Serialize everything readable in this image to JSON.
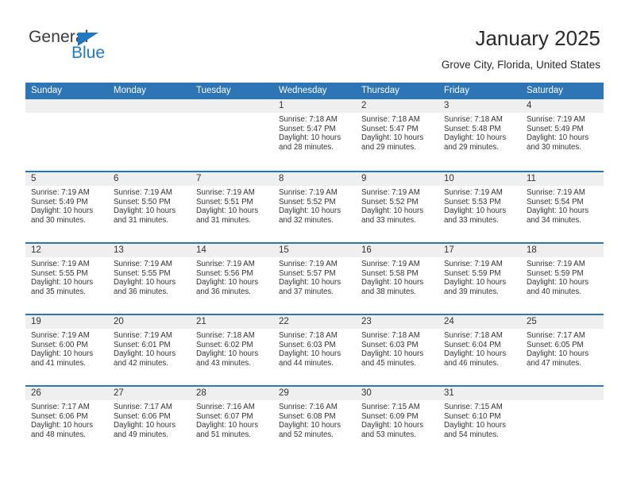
{
  "brand": {
    "name_top": "General",
    "name_bottom": "Blue",
    "triangle_icon": "triangle-icon",
    "accent_color": "#1f78c1"
  },
  "header": {
    "title": "January 2025",
    "subtitle": "Grove City, Florida, United States"
  },
  "theme": {
    "header_blue": "#2e75b6",
    "daynum_band": "#efefef",
    "text": "#333333"
  },
  "calendar": {
    "weekday_headers": [
      "Sunday",
      "Monday",
      "Tuesday",
      "Wednesday",
      "Thursday",
      "Friday",
      "Saturday"
    ],
    "weeks": [
      [
        {
          "day": "",
          "empty": true
        },
        {
          "day": "",
          "empty": true
        },
        {
          "day": "",
          "empty": true
        },
        {
          "day": "1",
          "sunrise": "Sunrise: 7:18 AM",
          "sunset": "Sunset: 5:47 PM",
          "daylight1": "Daylight: 10 hours",
          "daylight2": "and 28 minutes."
        },
        {
          "day": "2",
          "sunrise": "Sunrise: 7:18 AM",
          "sunset": "Sunset: 5:47 PM",
          "daylight1": "Daylight: 10 hours",
          "daylight2": "and 29 minutes."
        },
        {
          "day": "3",
          "sunrise": "Sunrise: 7:18 AM",
          "sunset": "Sunset: 5:48 PM",
          "daylight1": "Daylight: 10 hours",
          "daylight2": "and 29 minutes."
        },
        {
          "day": "4",
          "sunrise": "Sunrise: 7:19 AM",
          "sunset": "Sunset: 5:49 PM",
          "daylight1": "Daylight: 10 hours",
          "daylight2": "and 30 minutes."
        }
      ],
      [
        {
          "day": "5",
          "sunrise": "Sunrise: 7:19 AM",
          "sunset": "Sunset: 5:49 PM",
          "daylight1": "Daylight: 10 hours",
          "daylight2": "and 30 minutes."
        },
        {
          "day": "6",
          "sunrise": "Sunrise: 7:19 AM",
          "sunset": "Sunset: 5:50 PM",
          "daylight1": "Daylight: 10 hours",
          "daylight2": "and 31 minutes."
        },
        {
          "day": "7",
          "sunrise": "Sunrise: 7:19 AM",
          "sunset": "Sunset: 5:51 PM",
          "daylight1": "Daylight: 10 hours",
          "daylight2": "and 31 minutes."
        },
        {
          "day": "8",
          "sunrise": "Sunrise: 7:19 AM",
          "sunset": "Sunset: 5:52 PM",
          "daylight1": "Daylight: 10 hours",
          "daylight2": "and 32 minutes."
        },
        {
          "day": "9",
          "sunrise": "Sunrise: 7:19 AM",
          "sunset": "Sunset: 5:52 PM",
          "daylight1": "Daylight: 10 hours",
          "daylight2": "and 33 minutes."
        },
        {
          "day": "10",
          "sunrise": "Sunrise: 7:19 AM",
          "sunset": "Sunset: 5:53 PM",
          "daylight1": "Daylight: 10 hours",
          "daylight2": "and 33 minutes."
        },
        {
          "day": "11",
          "sunrise": "Sunrise: 7:19 AM",
          "sunset": "Sunset: 5:54 PM",
          "daylight1": "Daylight: 10 hours",
          "daylight2": "and 34 minutes."
        }
      ],
      [
        {
          "day": "12",
          "sunrise": "Sunrise: 7:19 AM",
          "sunset": "Sunset: 5:55 PM",
          "daylight1": "Daylight: 10 hours",
          "daylight2": "and 35 minutes."
        },
        {
          "day": "13",
          "sunrise": "Sunrise: 7:19 AM",
          "sunset": "Sunset: 5:55 PM",
          "daylight1": "Daylight: 10 hours",
          "daylight2": "and 36 minutes."
        },
        {
          "day": "14",
          "sunrise": "Sunrise: 7:19 AM",
          "sunset": "Sunset: 5:56 PM",
          "daylight1": "Daylight: 10 hours",
          "daylight2": "and 36 minutes."
        },
        {
          "day": "15",
          "sunrise": "Sunrise: 7:19 AM",
          "sunset": "Sunset: 5:57 PM",
          "daylight1": "Daylight: 10 hours",
          "daylight2": "and 37 minutes."
        },
        {
          "day": "16",
          "sunrise": "Sunrise: 7:19 AM",
          "sunset": "Sunset: 5:58 PM",
          "daylight1": "Daylight: 10 hours",
          "daylight2": "and 38 minutes."
        },
        {
          "day": "17",
          "sunrise": "Sunrise: 7:19 AM",
          "sunset": "Sunset: 5:59 PM",
          "daylight1": "Daylight: 10 hours",
          "daylight2": "and 39 minutes."
        },
        {
          "day": "18",
          "sunrise": "Sunrise: 7:19 AM",
          "sunset": "Sunset: 5:59 PM",
          "daylight1": "Daylight: 10 hours",
          "daylight2": "and 40 minutes."
        }
      ],
      [
        {
          "day": "19",
          "sunrise": "Sunrise: 7:19 AM",
          "sunset": "Sunset: 6:00 PM",
          "daylight1": "Daylight: 10 hours",
          "daylight2": "and 41 minutes."
        },
        {
          "day": "20",
          "sunrise": "Sunrise: 7:19 AM",
          "sunset": "Sunset: 6:01 PM",
          "daylight1": "Daylight: 10 hours",
          "daylight2": "and 42 minutes."
        },
        {
          "day": "21",
          "sunrise": "Sunrise: 7:18 AM",
          "sunset": "Sunset: 6:02 PM",
          "daylight1": "Daylight: 10 hours",
          "daylight2": "and 43 minutes."
        },
        {
          "day": "22",
          "sunrise": "Sunrise: 7:18 AM",
          "sunset": "Sunset: 6:03 PM",
          "daylight1": "Daylight: 10 hours",
          "daylight2": "and 44 minutes."
        },
        {
          "day": "23",
          "sunrise": "Sunrise: 7:18 AM",
          "sunset": "Sunset: 6:03 PM",
          "daylight1": "Daylight: 10 hours",
          "daylight2": "and 45 minutes."
        },
        {
          "day": "24",
          "sunrise": "Sunrise: 7:18 AM",
          "sunset": "Sunset: 6:04 PM",
          "daylight1": "Daylight: 10 hours",
          "daylight2": "and 46 minutes."
        },
        {
          "day": "25",
          "sunrise": "Sunrise: 7:17 AM",
          "sunset": "Sunset: 6:05 PM",
          "daylight1": "Daylight: 10 hours",
          "daylight2": "and 47 minutes."
        }
      ],
      [
        {
          "day": "26",
          "sunrise": "Sunrise: 7:17 AM",
          "sunset": "Sunset: 6:06 PM",
          "daylight1": "Daylight: 10 hours",
          "daylight2": "and 48 minutes."
        },
        {
          "day": "27",
          "sunrise": "Sunrise: 7:17 AM",
          "sunset": "Sunset: 6:06 PM",
          "daylight1": "Daylight: 10 hours",
          "daylight2": "and 49 minutes."
        },
        {
          "day": "28",
          "sunrise": "Sunrise: 7:16 AM",
          "sunset": "Sunset: 6:07 PM",
          "daylight1": "Daylight: 10 hours",
          "daylight2": "and 51 minutes."
        },
        {
          "day": "29",
          "sunrise": "Sunrise: 7:16 AM",
          "sunset": "Sunset: 6:08 PM",
          "daylight1": "Daylight: 10 hours",
          "daylight2": "and 52 minutes."
        },
        {
          "day": "30",
          "sunrise": "Sunrise: 7:15 AM",
          "sunset": "Sunset: 6:09 PM",
          "daylight1": "Daylight: 10 hours",
          "daylight2": "and 53 minutes."
        },
        {
          "day": "31",
          "sunrise": "Sunrise: 7:15 AM",
          "sunset": "Sunset: 6:10 PM",
          "daylight1": "Daylight: 10 hours",
          "daylight2": "and 54 minutes."
        },
        {
          "day": "",
          "empty": true
        }
      ]
    ]
  }
}
